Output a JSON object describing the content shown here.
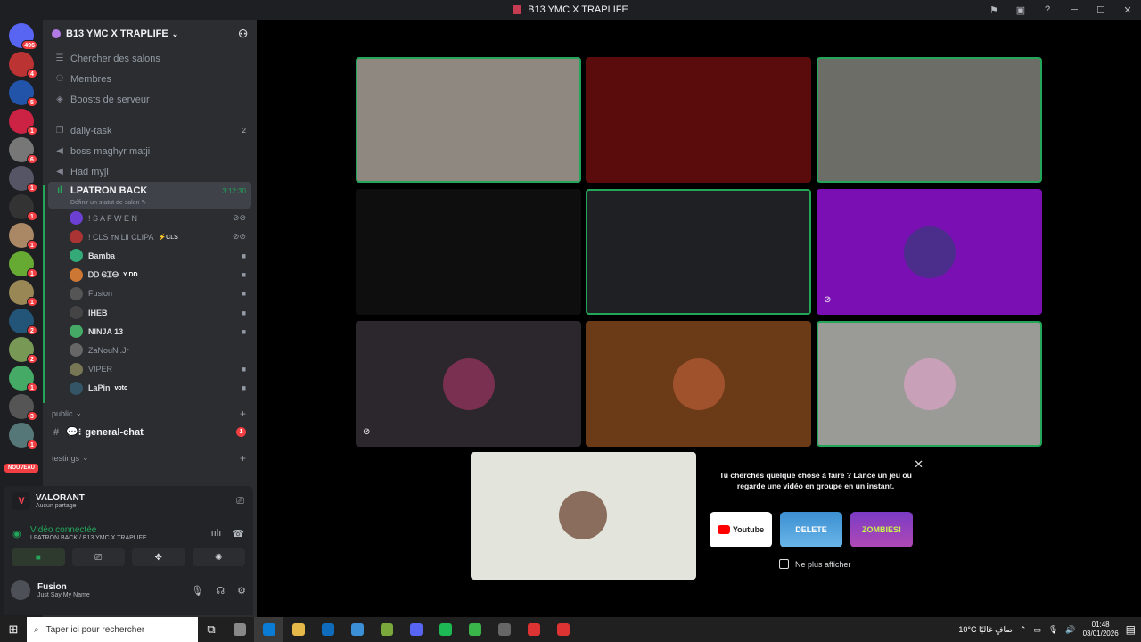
{
  "window": {
    "title": "B13 YMC X TRAPLIFE",
    "controls": [
      "─",
      "☐",
      "✕"
    ]
  },
  "guilds": {
    "home_badge": "496",
    "items": [
      {
        "badge": "4",
        "color": "#b33"
      },
      {
        "badge": "5",
        "color": "#2255aa"
      },
      {
        "badge": "1",
        "color": "#c24"
      },
      {
        "badge": "6",
        "color": "#777"
      },
      {
        "badge": "1",
        "color": "#556"
      },
      {
        "badge": "1",
        "color": "#333"
      },
      {
        "badge": "1",
        "color": "#a86"
      },
      {
        "badge": "1",
        "color": "#6a3"
      },
      {
        "badge": "1",
        "color": "#985"
      },
      {
        "badge": "2",
        "color": "#257"
      },
      {
        "badge": "2",
        "color": "#795"
      },
      {
        "badge": "1",
        "color": "#4a6"
      },
      {
        "badge": "3",
        "color": "#555"
      },
      {
        "badge": "1",
        "color": "#577"
      }
    ],
    "new_label": "NOUVEAU"
  },
  "server": {
    "name": "B13 YMC X TRAPLIFE",
    "menu": [
      "Chercher des salons",
      "Membres",
      "Boosts de serveur"
    ],
    "channels": [
      {
        "name": "daily-task",
        "count": "2"
      },
      {
        "name": "boss maghyr matji",
        "count": ""
      },
      {
        "name": "Had myji",
        "count": ""
      }
    ],
    "voice_channel": {
      "name": "LPATRON BACK",
      "timer": "3:12:30",
      "status": "Définir un statut de salon ✎"
    },
    "voice_users": [
      {
        "name": "! S A F W E N",
        "tag": "",
        "dim": true,
        "color": "#6b3fd1"
      },
      {
        "name": "! CLS ᴛɴ Lil CLIPA",
        "tag": "⚡CLS",
        "dim": true,
        "color": "#a33"
      },
      {
        "name": "Bamba",
        "tag": "",
        "dim": false,
        "color": "#3a7"
      },
      {
        "name": "ᎠᎠ ᎶᏆᎾ",
        "tag": "Y DD",
        "dim": false,
        "color": "#c73"
      },
      {
        "name": "Fusion",
        "tag": "",
        "dim": true,
        "color": "#555"
      },
      {
        "name": "IHEB",
        "tag": "",
        "dim": false,
        "color": "#444"
      },
      {
        "name": "NINJA 13",
        "tag": "",
        "dim": false,
        "color": "#4a6"
      },
      {
        "name": "ZaNouNi.Jr",
        "tag": "",
        "dim": true,
        "color": "#666"
      },
      {
        "name": "VIPER",
        "tag": "",
        "dim": true,
        "color": "#775"
      },
      {
        "name": "LaPin",
        "tag": "voto",
        "dim": false,
        "color": "#356"
      }
    ],
    "categories": [
      "public",
      "testings"
    ],
    "general_chat": {
      "name": "general-chat",
      "badge": "1"
    }
  },
  "panel": {
    "activity": {
      "title": "VALORANT",
      "subtitle": "Aucun partage"
    },
    "voice": {
      "status": "Vidéo connectée",
      "location": "LPATRON BACK / B13 YMC X TRAPLIFE"
    },
    "user": {
      "name": "Fusion",
      "status": "Just Say My Name"
    }
  },
  "stage": {
    "tiles": [
      {
        "bg": "#8f8880",
        "speaking": true,
        "muted": false
      },
      {
        "bg": "#5a0b0b",
        "speaking": false,
        "muted": false
      },
      {
        "bg": "#6b6d66",
        "speaking": true,
        "muted": false
      },
      {
        "bg": "#0e0e0e",
        "speaking": false,
        "muted": false
      },
      {
        "bg": "#1f2024",
        "speaking": true,
        "muted": false
      },
      {
        "bg": "#7a10b3",
        "speaking": false,
        "muted": true
      },
      {
        "bg": "#2b272c",
        "speaking": false,
        "muted": true
      },
      {
        "bg": "#6b3a16",
        "speaking": false,
        "muted": false
      },
      {
        "bg": "#9a9b97",
        "speaking": true,
        "muted": false
      }
    ],
    "suggest": {
      "message": "Tu cherches quelque chose à faire ? Lance un jeu ou regarde une vidéo en groupe en un instant.",
      "games": [
        "Youtube",
        "DELETE",
        "ZOMBIES!"
      ],
      "dont_show": "Ne plus afficher"
    }
  },
  "taskbar": {
    "search_placeholder": "Taper ici pour rechercher",
    "weather": "10°C صافٍ غالبًا",
    "time": "01:48",
    "date": "03/01/2026",
    "apps": [
      "#888",
      "#0a7cd6",
      "#e6b84a",
      "#0f6cbd",
      "#3a8fd6",
      "#7aa83a",
      "#5865f2",
      "#1db954",
      "#3ab54a",
      "#666",
      "#d33",
      "#d33"
    ]
  }
}
